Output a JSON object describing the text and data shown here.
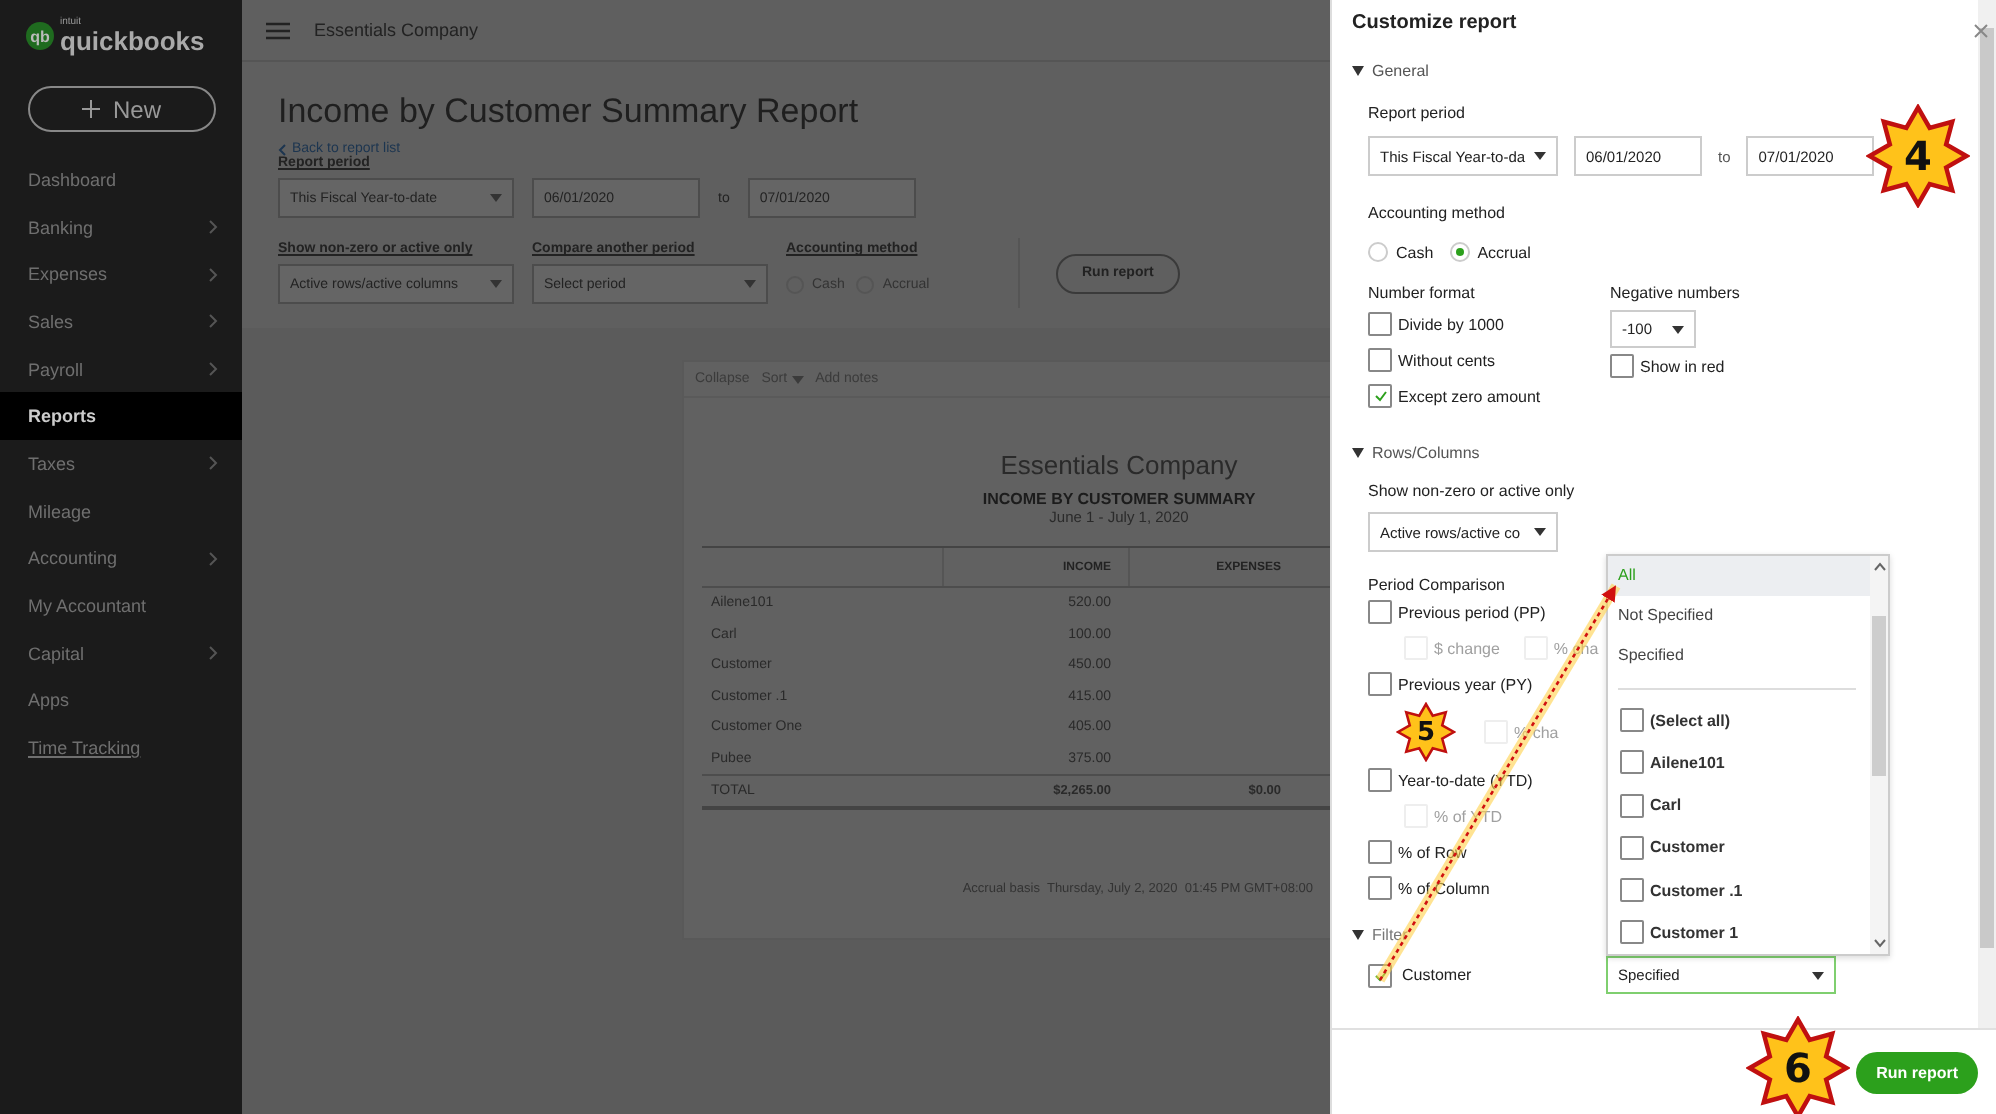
{
  "app": {
    "logo_mark": "qb",
    "logo_small": "intuit",
    "logo": "quickbooks",
    "new_button": "New"
  },
  "sidebar": {
    "items": [
      {
        "label": "Dashboard",
        "selected": false,
        "expandable": false,
        "kind": "item"
      },
      {
        "label": "Banking",
        "selected": false,
        "expandable": true,
        "kind": "item"
      },
      {
        "label": "Expenses",
        "selected": false,
        "expandable": true,
        "kind": "item"
      },
      {
        "label": "Sales",
        "selected": false,
        "expandable": true,
        "kind": "item"
      },
      {
        "label": "Payroll",
        "selected": false,
        "expandable": true,
        "kind": "item"
      },
      {
        "label": "Reports",
        "selected": true,
        "expandable": false,
        "kind": "item"
      },
      {
        "label": "Taxes",
        "selected": false,
        "expandable": true,
        "kind": "item"
      },
      {
        "label": "Mileage",
        "selected": false,
        "expandable": false,
        "kind": "item"
      },
      {
        "label": "Accounting",
        "selected": false,
        "expandable": true,
        "kind": "item"
      },
      {
        "label": "My Accountant",
        "selected": false,
        "expandable": false,
        "kind": "item"
      },
      {
        "label": "Capital",
        "selected": false,
        "expandable": true,
        "kind": "item"
      },
      {
        "label": "Apps",
        "selected": false,
        "expandable": false,
        "kind": "item"
      },
      {
        "label": "Time Tracking",
        "selected": false,
        "expandable": false,
        "kind": "link"
      }
    ]
  },
  "topbar": {
    "company": "Essentials Company"
  },
  "report_header": {
    "title": "Income by Customer Summary Report",
    "back_link": "Back to report list",
    "period_label": "Report period",
    "period_select": "This Fiscal Year-to-date",
    "from": "06/01/2020",
    "to_label": "to",
    "to": "07/01/2020",
    "show_label": "Show non-zero or active only",
    "show_select": "Active rows/active columns",
    "compare_label": "Compare another period",
    "compare_select": "Select period",
    "method_label": "Accounting method",
    "methods": [
      {
        "label": "Cash",
        "selected": false
      },
      {
        "label": "Accrual",
        "selected": false
      }
    ],
    "run_button": "Run report"
  },
  "report": {
    "toolbar": [
      "Collapse",
      "Sort",
      "Add notes"
    ],
    "company": "Essentials Company",
    "title": "INCOME BY CUSTOMER SUMMARY",
    "date_range": "June 1 - July 1, 2020",
    "columns": [
      "INCOME",
      "EXPENSES"
    ],
    "rows": [
      {
        "name": "Ailene101",
        "income": "520.00"
      },
      {
        "name": "Carl",
        "income": "100.00"
      },
      {
        "name": "Customer",
        "income": "450.00"
      },
      {
        "name": "Customer .1",
        "income": "415.00"
      },
      {
        "name": "Customer One",
        "income": "405.00"
      },
      {
        "name": "Pubee",
        "income": "375.00"
      }
    ],
    "total": {
      "name": "TOTAL",
      "income": "$2,265.00",
      "expenses": "$0.00"
    },
    "footer": "Accrual basis  Thursday, July 2, 2020  01:45 PM GMT+08:00"
  },
  "customize": {
    "title": "Customize report",
    "general": {
      "heading": "General",
      "expanded": true
    },
    "period_label": "Report period",
    "period_select": "This Fiscal Year-to-da",
    "from": "06/01/2020",
    "to_label": "to",
    "to": "07/01/2020",
    "method_label": "Accounting method",
    "methods": [
      {
        "label": "Cash",
        "selected": false
      },
      {
        "label": "Accrual",
        "selected": true
      }
    ],
    "number_format_label": "Number format",
    "number_format": [
      {
        "label": "Divide by 1000",
        "checked": false
      },
      {
        "label": "Without cents",
        "checked": false
      },
      {
        "label": "Except zero amount",
        "checked": true
      }
    ],
    "negative_label": "Negative numbers",
    "negative_select": "-100",
    "show_in_red": {
      "label": "Show in red",
      "checked": false
    },
    "rows_columns": {
      "heading": "Rows/Columns",
      "expanded": true
    },
    "show_label": "Show non-zero or active only",
    "show_select": "Active rows/active co",
    "comparison_label": "Period Comparison",
    "comparison": [
      {
        "label": "Previous period (PP)",
        "checked": false,
        "options": [
          {
            "label": "$ change",
            "checked": false,
            "disabled": true
          },
          {
            "label": "% cha",
            "checked": false,
            "disabled": true
          }
        ]
      },
      {
        "label": "Previous year (PY)",
        "checked": false,
        "options": [
          {
            "label": "% cha",
            "checked": false,
            "disabled": true
          }
        ]
      },
      {
        "label": "Year-to-date (YTD)",
        "checked": false,
        "options": [
          {
            "label": "% of YTD",
            "checked": false,
            "disabled": true
          }
        ]
      },
      {
        "label": "% of Row",
        "checked": false
      },
      {
        "label": "% of Column",
        "checked": false
      }
    ],
    "filter": {
      "heading": "Filter",
      "expanded": true
    },
    "customer_filter": {
      "label": "Customer",
      "checked": true,
      "value": "Specified"
    },
    "dropdown": {
      "options": [
        {
          "label": "All",
          "selected": true
        },
        {
          "label": "Not Specified",
          "selected": false
        },
        {
          "label": "Specified",
          "selected": false
        }
      ],
      "customers": [
        {
          "label": "(Select all)",
          "checked": false
        },
        {
          "label": "Ailene101",
          "checked": false
        },
        {
          "label": "Carl",
          "checked": false
        },
        {
          "label": "Customer",
          "checked": false
        },
        {
          "label": "Customer .1",
          "checked": false
        },
        {
          "label": "Customer 1",
          "checked": false
        }
      ]
    },
    "run_button": "Run report"
  },
  "callouts": [
    {
      "label": "4"
    },
    {
      "label": "5"
    },
    {
      "label": "6"
    }
  ]
}
